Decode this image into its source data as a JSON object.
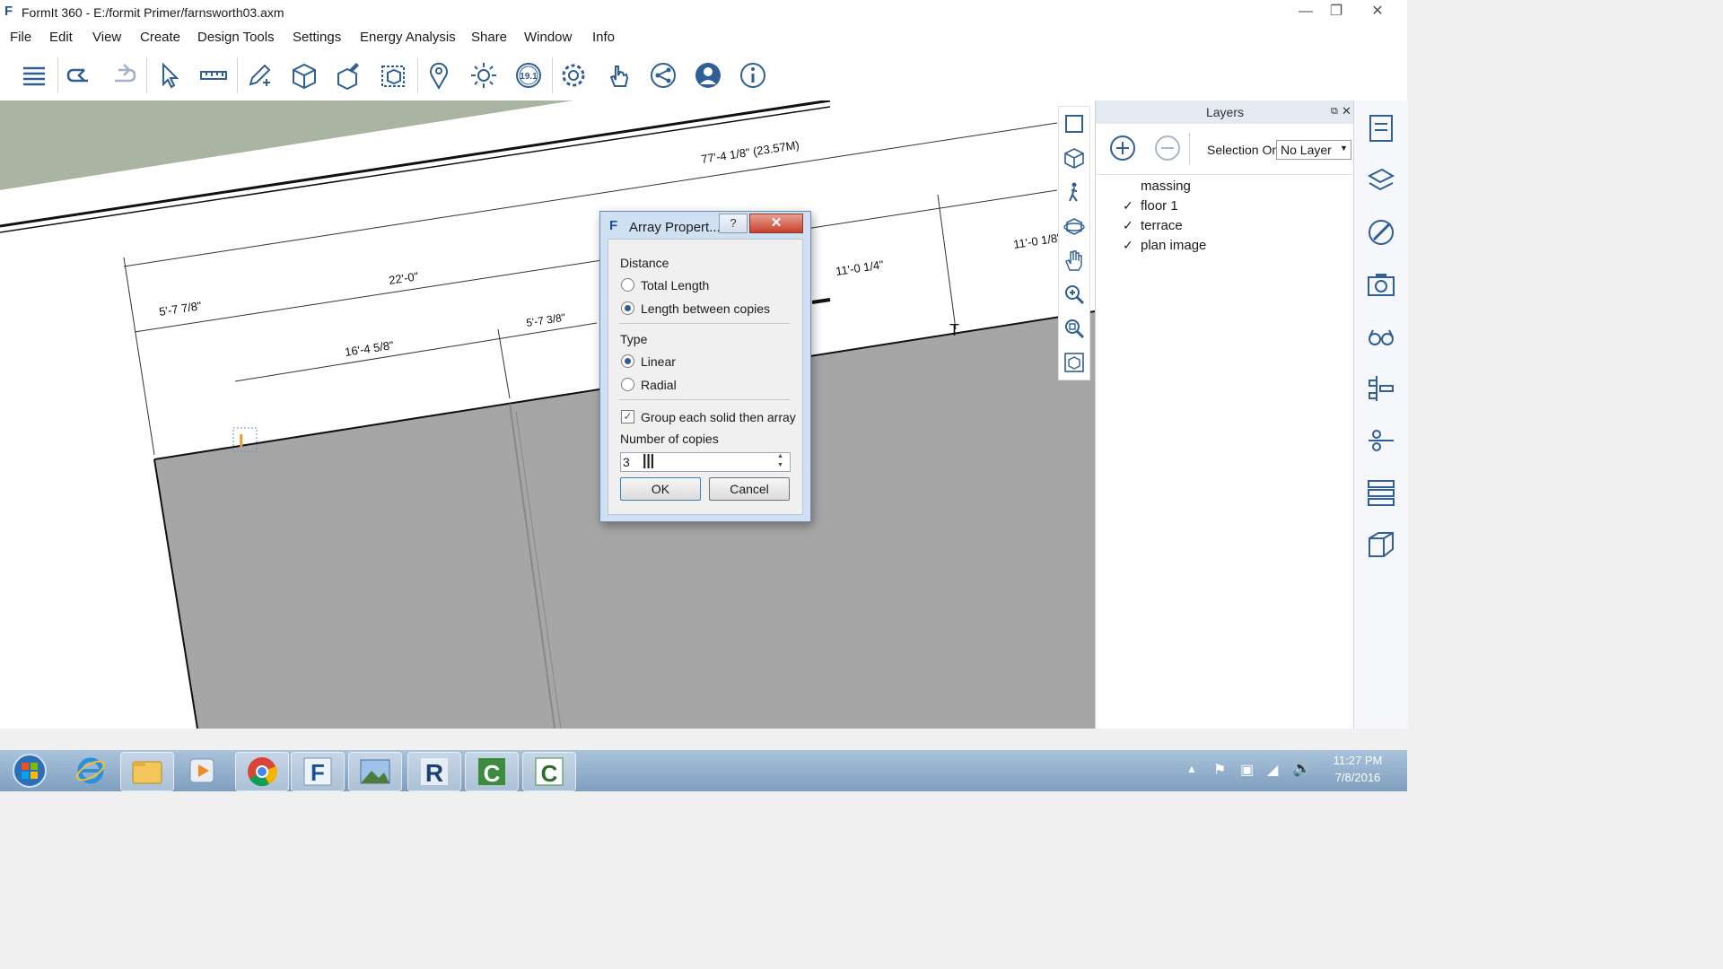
{
  "window": {
    "title": "FormIt 360 - E:/formit Primer/farnsworth03.axm",
    "logo": "F"
  },
  "menu": [
    "File",
    "Edit",
    "View",
    "Create",
    "Design Tools",
    "Settings",
    "Energy Analysis",
    "Share",
    "Window",
    "Info"
  ],
  "toolbar": {
    "icons": [
      "list-icon",
      "undo-icon",
      "redo-icon",
      "select-arrow-icon",
      "measure-icon",
      "sketch-pencil-icon",
      "add-cube-icon",
      "add-object-icon",
      "group-icon",
      "location-pin-icon",
      "sun-icon",
      "version-badge-icon",
      "settings-gear-icon",
      "touch-icon",
      "share-icon",
      "user-icon",
      "info-icon"
    ],
    "version_badge": "19.1"
  },
  "canvas": {
    "dimensions": [
      "77'-4 1/8\" (23.57M)",
      "22'-0\"",
      "5'-7 7/8\"",
      "5'-7 3/8\"",
      "16'-4 5/8\"",
      "11'-0 1/4\"",
      "11'-0 1/8\""
    ]
  },
  "layers_panel": {
    "title": "Layers",
    "selection_label": "Selection On",
    "selection_value": "No Layer",
    "layers": [
      {
        "name": "massing",
        "checked": false
      },
      {
        "name": "floor 1",
        "checked": true
      },
      {
        "name": "terrace",
        "checked": true
      },
      {
        "name": "plan image",
        "checked": true
      }
    ]
  },
  "dialog": {
    "title": "Array Propert...",
    "help": "?",
    "distance_label": "Distance",
    "total_length": "Total Length",
    "length_between": "Length between copies",
    "type_label": "Type",
    "linear": "Linear",
    "radial": "Radial",
    "group_each": "Group each solid then array",
    "copies_label": "Number of copies",
    "copies_value": "3",
    "ok": "OK",
    "cancel": "Cancel"
  },
  "taskbar": {
    "clock_time": "11:27 PM",
    "clock_date": "7/8/2016"
  }
}
